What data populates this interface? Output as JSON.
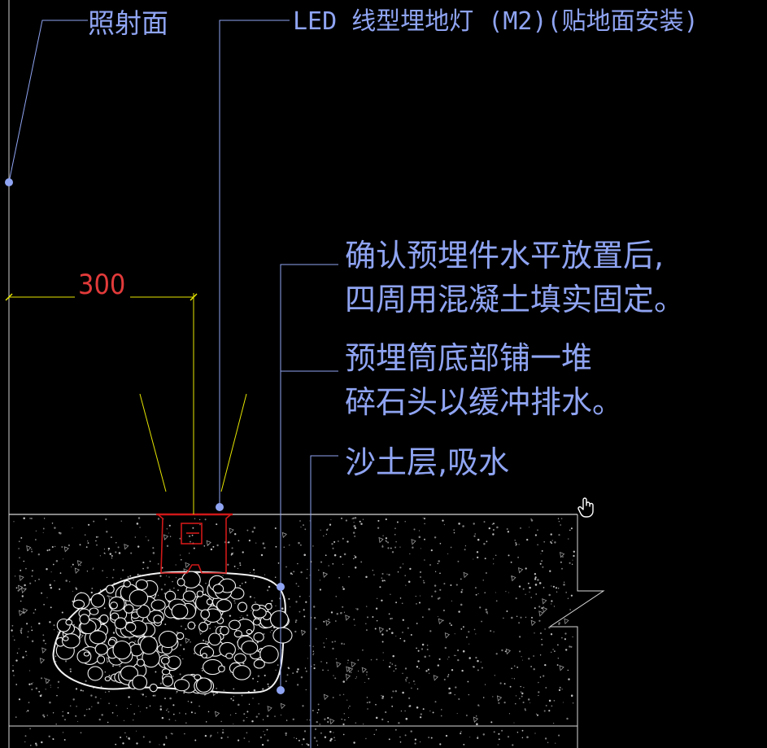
{
  "labels": {
    "illuminated_surface": "照射面",
    "led_fixture": "LED 线型埋地灯 (M2)(贴地面安装)",
    "level_line1": "确认预埋件水平放置后,",
    "level_line2": "四周用混凝土填实固定。",
    "gravel_line1": "预埋筒底部铺一堆",
    "gravel_line2": "碎石头以缓冲排水。",
    "sand_layer": "沙土层,吸水"
  },
  "dimension": {
    "value": "300"
  },
  "colors": {
    "background": "#000000",
    "leader": "#8fa4f2",
    "dimension_line": "#e6e600",
    "dimension_text": "#e23a3a",
    "fixture": "#d01818",
    "ground_outline": "#d8d8d8",
    "gravel": "#f2f2f2"
  },
  "icons": {
    "cursor": "hand-pointer-icon"
  }
}
